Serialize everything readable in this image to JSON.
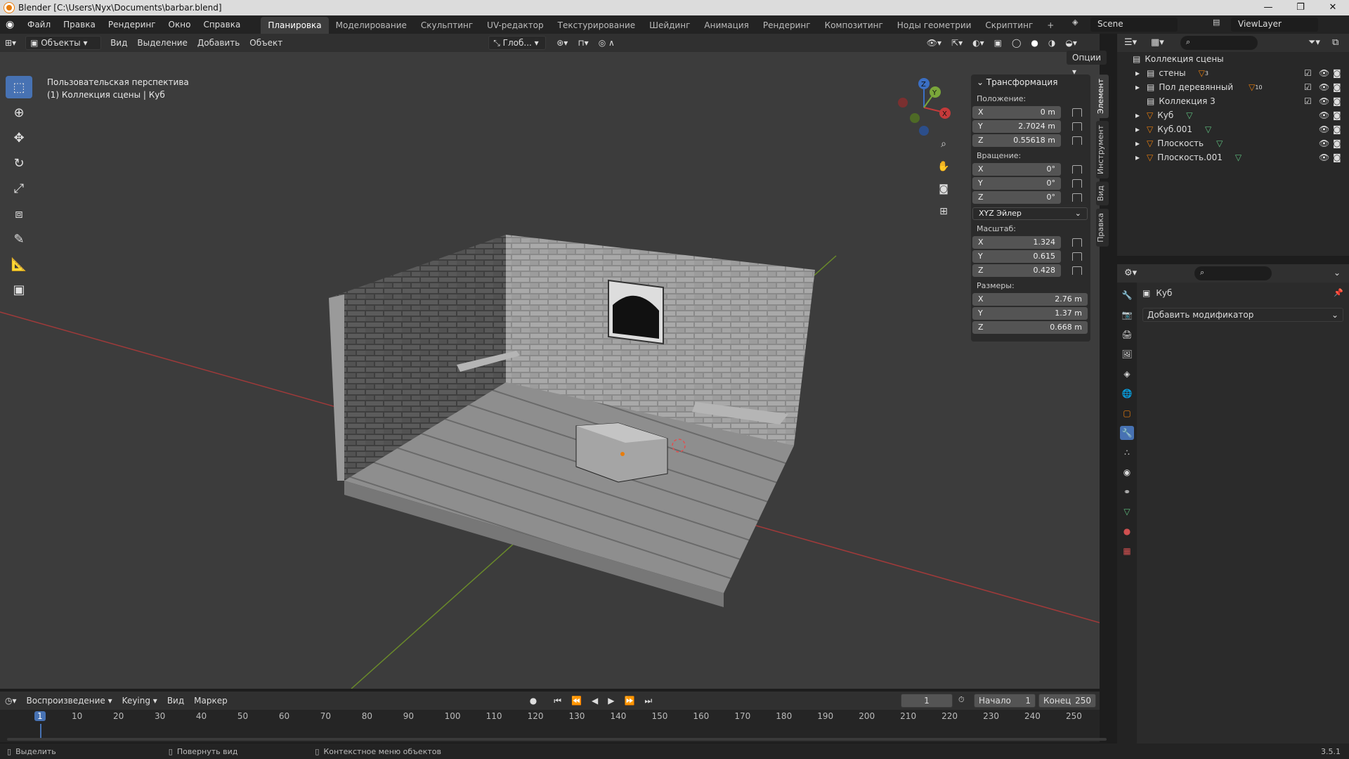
{
  "window": {
    "title": "Blender [C:\\Users\\Nyx\\Documents\\barbar.blend]"
  },
  "menus": [
    "Файл",
    "Правка",
    "Рендеринг",
    "Окно",
    "Справка"
  ],
  "workspaces": [
    "Планировка",
    "Моделирование",
    "Скульптинг",
    "UV-редактор",
    "Текстурирование",
    "Шейдинг",
    "Анимация",
    "Рендеринг",
    "Композитинг",
    "Ноды геометрии",
    "Скриптинг"
  ],
  "active_workspace": "Планировка",
  "scene": {
    "name": "Scene",
    "view_layer": "ViewLayer"
  },
  "header3d": {
    "mode": "Объекты",
    "menus": [
      "Вид",
      "Выделение",
      "Добавить",
      "Объект"
    ],
    "orientation": "Глоб...",
    "options": "Опции"
  },
  "viewport": {
    "perspective_label": "Пользовательская перспектива",
    "collection_label": "(1) Коллекция сцены | Куб"
  },
  "npanel": {
    "section": "Трансформация",
    "location_label": "Положение:",
    "location": {
      "x": "0 m",
      "y": "2.7024 m",
      "z": "0.55618 m"
    },
    "rotation_label": "Вращение:",
    "rotation": {
      "x": "0°",
      "y": "0°",
      "z": "0°"
    },
    "rotation_mode": "XYZ Эйлер",
    "scale_label": "Масштаб:",
    "scale": {
      "x": "1.324",
      "y": "0.615",
      "z": "0.428"
    },
    "dimensions_label": "Размеры:",
    "dimensions": {
      "x": "2.76 m",
      "y": "1.37 m",
      "z": "0.668 m"
    },
    "tabs": [
      "Элемент",
      "Инструмент",
      "Вид",
      "Правка"
    ]
  },
  "outliner": {
    "root": "Коллекция сцены",
    "items": [
      {
        "name": "стены",
        "badge": "3"
      },
      {
        "name": "Пол деревянный",
        "badge": "10"
      },
      {
        "name": "Коллекция 3",
        "badge": ""
      },
      {
        "name": "Куб",
        "badge": ""
      },
      {
        "name": "Куб.001",
        "badge": ""
      },
      {
        "name": "Плоскость",
        "badge": ""
      },
      {
        "name": "Плоскость.001",
        "badge": ""
      }
    ]
  },
  "properties": {
    "object_name": "Куб",
    "add_modifier": "Добавить модификатор"
  },
  "timeline": {
    "menus": [
      "Воспроизведение",
      "Keying",
      "Вид",
      "Маркер"
    ],
    "current_frame": "1",
    "start_label": "Начало",
    "start": "1",
    "end_label": "Конец",
    "end": "250",
    "ticks": [
      "1",
      "10",
      "20",
      "30",
      "40",
      "50",
      "60",
      "70",
      "80",
      "90",
      "100",
      "110",
      "120",
      "130",
      "140",
      "150",
      "160",
      "170",
      "180",
      "190",
      "200",
      "210",
      "220",
      "230",
      "240",
      "250"
    ]
  },
  "statusbar": {
    "select": "Выделить",
    "rotate_view": "Повернуть вид",
    "context_menu": "Контекстное меню объектов",
    "version": "3.5.1"
  },
  "colors": {
    "accent": "#4772b3",
    "x_axis": "#c43a3a",
    "y_axis": "#7aa63a",
    "z_axis": "#3b6fc4",
    "orange": "#e87d0d"
  }
}
